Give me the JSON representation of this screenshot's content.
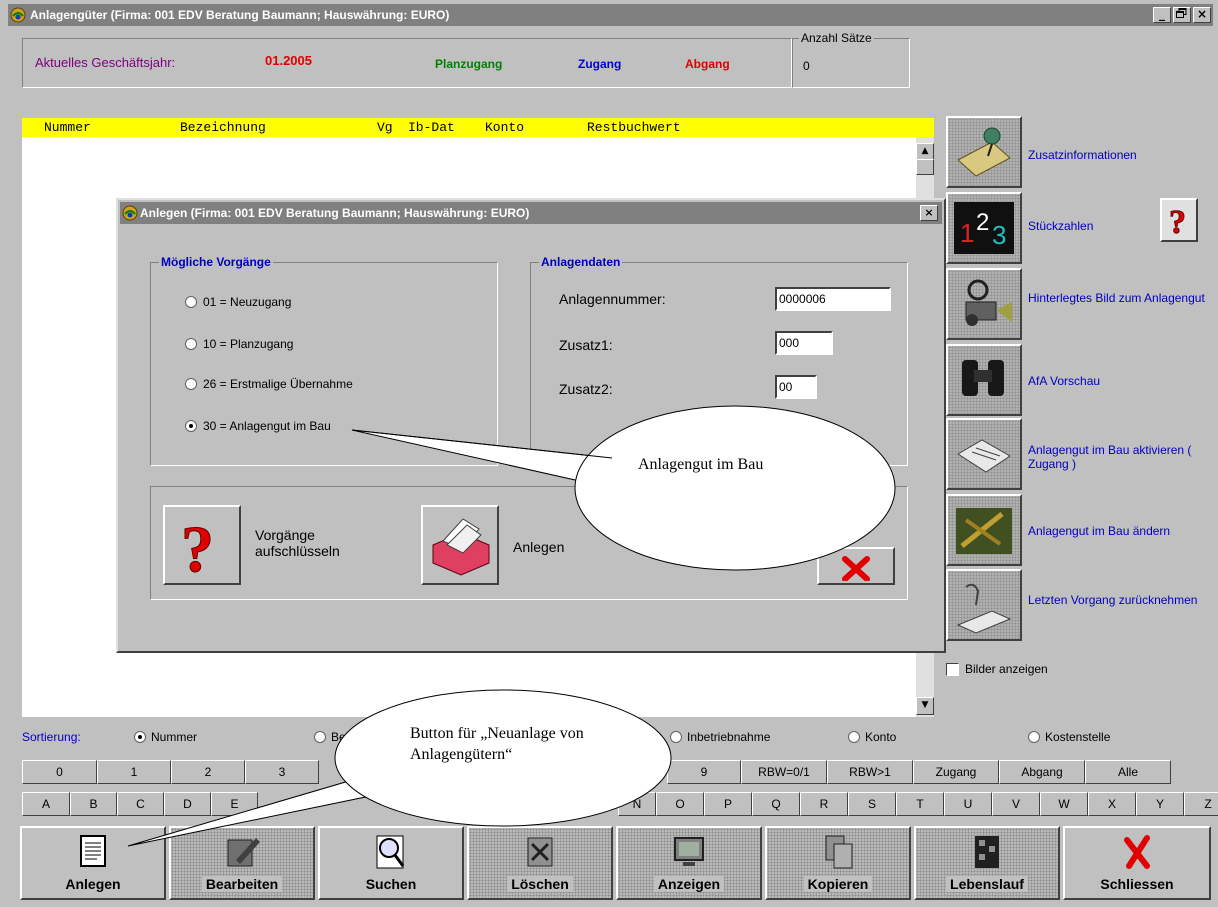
{
  "app": {
    "title": "Anlagengüter  (Firma: 001 EDV Beratung Baumann;   Hauswährung: EURO)",
    "window_controls": [
      "_",
      "8",
      "×"
    ]
  },
  "fiscal": {
    "label": "Aktuelles Geschäftsjahr:",
    "year": "01.2005",
    "planzugang": "Planzugang",
    "zugang": "Zugang",
    "abgang": "Abgang",
    "colors": {
      "label": "#800080",
      "year": "#e00000",
      "planzugang": "#008000",
      "zugang": "#0000e0",
      "abgang": "#e00000"
    }
  },
  "count": {
    "legend": "Anzahl Sätze",
    "value": "0"
  },
  "table_header": {
    "columns": [
      "Nummer",
      "Bezeichnung",
      "Vg",
      "Ib-Dat",
      "Konto",
      "Restbuchwert"
    ],
    "background": "#ffff00"
  },
  "side_actions": [
    {
      "label": "Zusatzinformationen",
      "icon": "pushpin-note-icon"
    },
    {
      "label": "Stückzahlen",
      "icon": "numbers-123-icon"
    },
    {
      "label": "Hinterlegtes Bild zum Anlagengut",
      "icon": "camera-icon"
    },
    {
      "label": "AfA Vorschau",
      "icon": "binoculars-icon"
    },
    {
      "label": "Anlagengut im Bau aktivieren ( Zugang )",
      "icon": "hand-document-icon"
    },
    {
      "label": "Anlagengut im Bau ändern",
      "icon": "construction-edit-icon"
    },
    {
      "label": "Letzten Vorgang zurücknehmen",
      "icon": "undo-hand-icon"
    }
  ],
  "show_images": {
    "label": "Bilder anzeigen",
    "checked": false
  },
  "sort": {
    "label": "Sortierung:",
    "options": [
      {
        "label": "Nummer",
        "selected": true
      },
      {
        "label": "Be",
        "selected": false
      },
      {
        "label": "Inbetriebnahme",
        "selected": false
      },
      {
        "label": "Konto",
        "selected": false
      },
      {
        "label": "Kostenstelle",
        "selected": false
      }
    ]
  },
  "digit_keys": [
    "0",
    "1",
    "2",
    "3",
    "9",
    "RBW=0/1",
    "RBW>1",
    "Zugang",
    "Abgang",
    "Alle"
  ],
  "letter_keys": [
    "A",
    "B",
    "C",
    "D",
    "E",
    "N",
    "O",
    "P",
    "Q",
    "R",
    "S",
    "T",
    "U",
    "V",
    "W",
    "X",
    "Y",
    "Z"
  ],
  "bottom_buttons": [
    {
      "label": "Anlegen",
      "icon": "document-icon"
    },
    {
      "label": "Bearbeiten",
      "icon": "edit-pen-icon"
    },
    {
      "label": "Suchen",
      "icon": "magnifier-icon"
    },
    {
      "label": "Löschen",
      "icon": "delete-doc-icon"
    },
    {
      "label": "Anzeigen",
      "icon": "monitor-icon"
    },
    {
      "label": "Kopieren",
      "icon": "copy-icon"
    },
    {
      "label": "Lebenslauf",
      "icon": "timeline-icon"
    },
    {
      "label": "Schliessen",
      "icon": "red-x-icon"
    }
  ],
  "dialog": {
    "title": "Anlegen  (Firma: 001 EDV Beratung Baumann;   Hauswährung: EURO)",
    "close": "×",
    "group_vorgaenge": {
      "legend": "Mögliche Vorgänge",
      "options": [
        {
          "label": "01 = Neuzugang",
          "selected": false
        },
        {
          "label": "10 = Planzugang",
          "selected": false
        },
        {
          "label": "26 = Erstmalige Übernahme",
          "selected": false
        },
        {
          "label": "30 = Anlagengut im Bau",
          "selected": true
        }
      ]
    },
    "group_daten": {
      "legend": "Anlagendaten",
      "fields": [
        {
          "label": "Anlagennummer:",
          "value": "0000006"
        },
        {
          "label": "Zusatz1:",
          "value": "000"
        },
        {
          "label": "Zusatz2:",
          "value": "00"
        }
      ]
    },
    "buttons": {
      "explain": "Vorgänge aufschlüsseln",
      "create": "Anlegen"
    }
  },
  "callouts": {
    "bau": "Anlagengut im Bau",
    "neuanlage": "Button für „Neuanlage von Anlagengütern“"
  }
}
